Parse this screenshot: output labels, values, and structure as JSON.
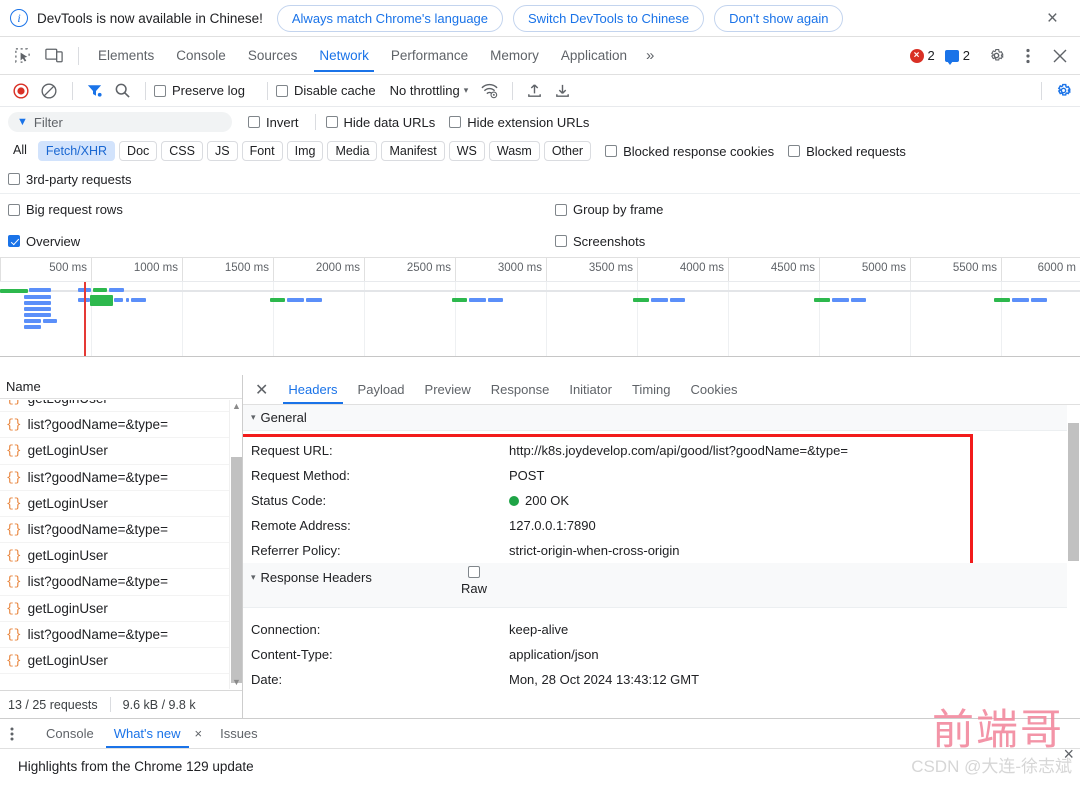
{
  "infobar": {
    "icon": "info-icon",
    "message": "DevTools is now available in Chinese!",
    "buttons": [
      {
        "label": "Always match Chrome's language"
      },
      {
        "label": "Switch DevTools to Chinese"
      },
      {
        "label": "Don't show again"
      }
    ],
    "close": "×"
  },
  "main_tabs": {
    "items": [
      {
        "label": "Elements",
        "active": false
      },
      {
        "label": "Console",
        "active": false
      },
      {
        "label": "Sources",
        "active": false
      },
      {
        "label": "Network",
        "active": true
      },
      {
        "label": "Performance",
        "active": false
      },
      {
        "label": "Memory",
        "active": false
      },
      {
        "label": "Application",
        "active": false
      }
    ],
    "more": "»",
    "error_count": "2",
    "message_count": "2",
    "settings_icon": "gear-icon",
    "kebab_icon": "more-vertical-icon",
    "close_icon": "close-icon"
  },
  "net_toolbar": {
    "record_icon": "record-icon",
    "clear_icon": "clear-icon",
    "filter_icon": "filter-icon",
    "search_icon": "search-icon",
    "preserve_log": {
      "label": "Preserve log",
      "checked": false
    },
    "disable_cache": {
      "label": "Disable cache",
      "checked": false
    },
    "throttling": "No throttling",
    "throttle_caret": "▾",
    "wifi_icon": "network-conditions-icon",
    "import_icon": "import-har-icon",
    "export_icon": "export-har-icon",
    "settings_icon": "network-settings-icon"
  },
  "filter_row": {
    "filter_placeholder": "Filter",
    "filter_value": "",
    "invert": {
      "label": "Invert",
      "checked": false
    },
    "hide_data_urls": {
      "label": "Hide data URLs",
      "checked": false
    },
    "hide_extension_urls": {
      "label": "Hide extension URLs",
      "checked": false
    }
  },
  "type_filters": {
    "chips": [
      {
        "label": "All",
        "selected": false,
        "plain": true
      },
      {
        "label": "Fetch/XHR",
        "selected": true
      },
      {
        "label": "Doc",
        "selected": false
      },
      {
        "label": "CSS",
        "selected": false
      },
      {
        "label": "JS",
        "selected": false
      },
      {
        "label": "Font",
        "selected": false
      },
      {
        "label": "Img",
        "selected": false
      },
      {
        "label": "Media",
        "selected": false
      },
      {
        "label": "Manifest",
        "selected": false
      },
      {
        "label": "WS",
        "selected": false
      },
      {
        "label": "Wasm",
        "selected": false
      },
      {
        "label": "Other",
        "selected": false
      }
    ],
    "blocked_response_cookies": {
      "label": "Blocked response cookies",
      "checked": false
    },
    "blocked_requests": {
      "label": "Blocked requests",
      "checked": false
    },
    "third_party": {
      "label": "3rd-party requests",
      "checked": false
    }
  },
  "options": {
    "big_request_rows": {
      "label": "Big request rows",
      "checked": false
    },
    "group_by_frame": {
      "label": "Group by frame",
      "checked": false
    },
    "overview": {
      "label": "Overview",
      "checked": true
    },
    "screenshots": {
      "label": "Screenshots",
      "checked": false
    }
  },
  "overview_timeline": {
    "ticks": [
      "500 ms",
      "1000 ms",
      "1500 ms",
      "2000 ms",
      "2500 ms",
      "3000 ms",
      "3500 ms",
      "4000 ms",
      "4500 ms",
      "5000 ms",
      "5500 ms",
      "6000 m"
    ]
  },
  "request_list": {
    "column_header": "Name",
    "rows": [
      {
        "name": "getLoginUser",
        "icon": "json-icon"
      },
      {
        "name": "list?goodName=&type=",
        "icon": "json-icon"
      },
      {
        "name": "getLoginUser",
        "icon": "json-icon"
      },
      {
        "name": "list?goodName=&type=",
        "icon": "json-icon"
      },
      {
        "name": "getLoginUser",
        "icon": "json-icon"
      },
      {
        "name": "list?goodName=&type=",
        "icon": "json-icon"
      },
      {
        "name": "getLoginUser",
        "icon": "json-icon"
      },
      {
        "name": "list?goodName=&type=",
        "icon": "json-icon"
      },
      {
        "name": "getLoginUser",
        "icon": "json-icon"
      },
      {
        "name": "list?goodName=&type=",
        "icon": "json-icon"
      },
      {
        "name": "getLoginUser",
        "icon": "json-icon"
      }
    ],
    "footer": {
      "requests": "13 / 25 requests",
      "size": "9.6 kB / 9.8 k"
    }
  },
  "details": {
    "close_icon": "close-icon",
    "tabs": [
      {
        "label": "Headers",
        "active": true
      },
      {
        "label": "Payload",
        "active": false
      },
      {
        "label": "Preview",
        "active": false
      },
      {
        "label": "Response",
        "active": false
      },
      {
        "label": "Initiator",
        "active": false
      },
      {
        "label": "Timing",
        "active": false
      },
      {
        "label": "Cookies",
        "active": false
      }
    ],
    "general": {
      "title": "General",
      "caret": "▾",
      "rows": [
        {
          "key": "Request URL:",
          "value": "http://k8s.joydevelop.com/api/good/list?goodName=&type="
        },
        {
          "key": "Request Method:",
          "value": "POST"
        },
        {
          "key": "Status Code:",
          "value": "200 OK",
          "status_dot": "#1ea446"
        },
        {
          "key": "Remote Address:",
          "value": "127.0.0.1:7890"
        },
        {
          "key": "Referrer Policy:",
          "value": "strict-origin-when-cross-origin"
        }
      ],
      "highlight_color": "#f21b1b"
    },
    "response_headers": {
      "title": "Response Headers",
      "caret": "▾",
      "raw_label": "Raw",
      "raw_checked": false,
      "rows": [
        {
          "key": "Connection:",
          "value": "keep-alive"
        },
        {
          "key": "Content-Type:",
          "value": "application/json"
        },
        {
          "key": "Date:",
          "value": "Mon, 28 Oct 2024 13:43:12 GMT"
        }
      ]
    }
  },
  "drawer": {
    "kebab_icon": "more-vertical-icon",
    "tabs": [
      {
        "label": "Console",
        "active": false,
        "closable": false
      },
      {
        "label": "What's new",
        "active": true,
        "closable": true
      },
      {
        "label": "Issues",
        "active": false,
        "closable": false
      }
    ],
    "close_icon": "×",
    "content": "Highlights from the Chrome 129 update"
  },
  "watermark": {
    "main": "前端哥",
    "sub": "CSDN @大连-徐志斌",
    "corner_close": "×"
  },
  "colors": {
    "accent": "#1a73e8",
    "selected_chip_bg": "#d2e3fc",
    "error_red": "#d93025",
    "highlight_red": "#f21b1b",
    "status_green": "#1ea446",
    "bar_blue": "#5b8ff9",
    "bar_green": "#2db84d",
    "watermark_pink": "#f28ca0"
  }
}
